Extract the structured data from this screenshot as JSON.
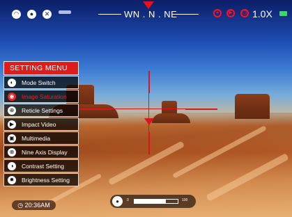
{
  "top_bar": {
    "left_icons": [
      "wifi-icon",
      "camera-mode-icon",
      "close-circle-icon"
    ],
    "compass_heading": "WN . N . NE",
    "right_icons": [
      "record-icon",
      "video-icon",
      "alarm-icon"
    ],
    "zoom_level": "1.0X",
    "battery_color": "#3ed66a"
  },
  "menu": {
    "title": "SETTING MENU",
    "items": [
      {
        "label": "Mode Switch",
        "icon": "mode-switch-icon",
        "glyph": "◐"
      },
      {
        "label": "Image Saturation",
        "icon": "saturation-icon",
        "glyph": "◉",
        "active": true
      },
      {
        "label": "Reticle Settings",
        "icon": "reticle-icon",
        "glyph": "⊕"
      },
      {
        "label": "Impact Video",
        "icon": "impact-video-icon",
        "glyph": "▶"
      },
      {
        "label": "Multimedia",
        "icon": "multimedia-icon",
        "glyph": "▣"
      },
      {
        "label": "Nine Axis Display",
        "icon": "nine-axis-icon",
        "glyph": "⊗"
      },
      {
        "label": "Contrast Setting",
        "icon": "contrast-icon",
        "glyph": "◑"
      },
      {
        "label": "Brightness Setting",
        "icon": "brightness-icon",
        "glyph": "✹"
      }
    ],
    "active_color": "#e72424",
    "title_color": "#dd1c1c"
  },
  "status": {
    "time": "20:36AM",
    "volume_min": "0",
    "volume_max": "100",
    "volume_fraction": 0.72
  },
  "reticle": {
    "color": "#d9161e"
  }
}
